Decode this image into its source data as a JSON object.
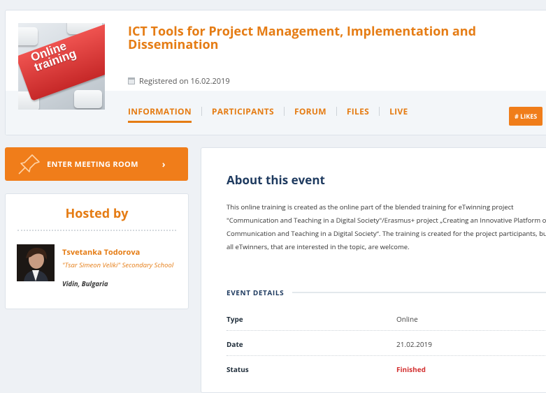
{
  "event": {
    "title": "ICT Tools for Project Management, Implementation and Dissemination",
    "registered": "Registered on 16.02.2019",
    "thumbnail_text": "Online training"
  },
  "tabs": [
    {
      "label": "INFORMATION",
      "active": true
    },
    {
      "label": "PARTICIPANTS",
      "active": false
    },
    {
      "label": "FORUM",
      "active": false
    },
    {
      "label": "FILES",
      "active": false
    },
    {
      "label": "LIVE",
      "active": false
    }
  ],
  "likes_label": "# LIKES",
  "meeting_button": {
    "label": "ENTER MEETING ROOM",
    "icon": "pin-icon"
  },
  "host": {
    "heading": "Hosted by",
    "name": "Tsvetanka Todorova",
    "school": "\"Tsar Simeon Veliki\" Secondary School",
    "location": "Vidin, Bulgaria"
  },
  "about": {
    "heading": "About this event",
    "text": "This online training is created as the online part of the blended training for eTwinning project \"Communication and Teaching in a Digital Society\"/Erasmus+ project „Creating an Innovative Platform of Communication and Teaching in a Digital Society“. The training is created for the project participants, but all eTwinners, that are interested in the topic, are welcome."
  },
  "details": {
    "heading": "EVENT DETAILS",
    "rows": [
      {
        "key": "Type",
        "value": "Online"
      },
      {
        "key": "Date",
        "value": "21.02.2019"
      },
      {
        "key": "Status",
        "value": "Finished"
      }
    ]
  },
  "colors": {
    "accent": "#e57c14",
    "button": "#f07d1a",
    "heading": "#1e3a5f",
    "status_finished": "#d32f2f"
  }
}
